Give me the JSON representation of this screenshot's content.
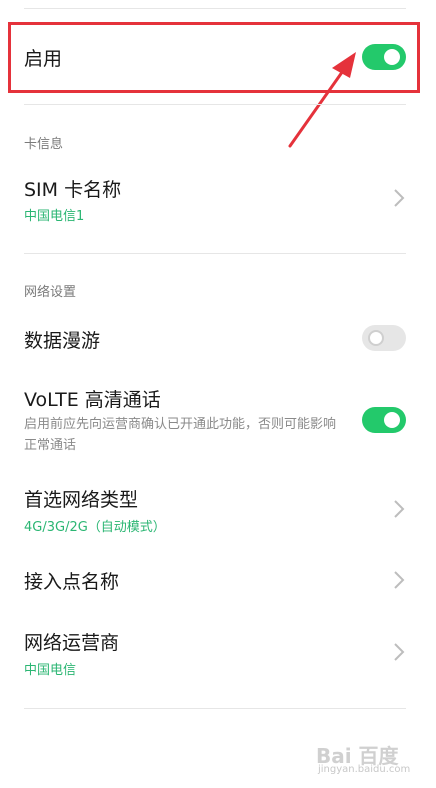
{
  "enable": {
    "label": "启用",
    "state": "on"
  },
  "card_info": {
    "section_label": "卡信息",
    "sim_name": {
      "title": "SIM 卡名称",
      "value": "中国电信1"
    }
  },
  "network": {
    "section_label": "网络设置",
    "data_roaming": {
      "title": "数据漫游",
      "state": "off"
    },
    "volte": {
      "title": "VoLTE 高清通话",
      "description": "启用前应先向运营商确认已开通此功能，否则可能影响正常通话",
      "state": "on"
    },
    "preferred_type": {
      "title": "首选网络类型",
      "value": "4G/3G/2G（自动模式）"
    },
    "apn": {
      "title": "接入点名称"
    },
    "operator": {
      "title": "网络运营商",
      "value": "中国电信"
    }
  },
  "watermark": {
    "logo": "Bai 百度",
    "url": "jingyan.baidu.com"
  },
  "colors": {
    "accent_green": "#23c96b",
    "highlight_red": "#e5323b"
  }
}
